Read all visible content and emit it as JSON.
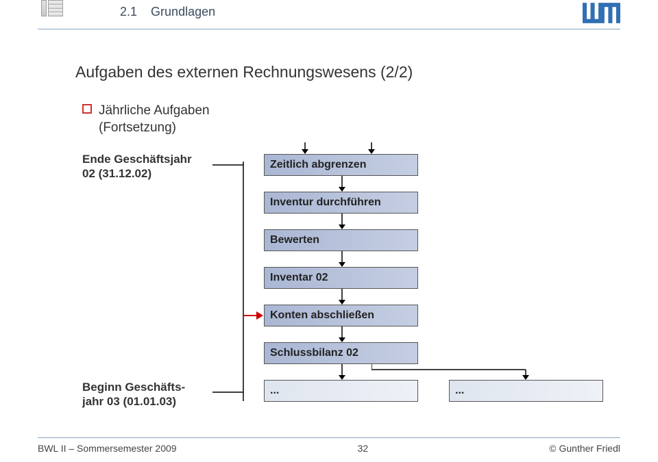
{
  "header": {
    "section_number": "2.1",
    "section_title": "Grundlagen"
  },
  "title": "Aufgaben des externen Rechnungswesens (2/2)",
  "bullet": {
    "line1": "Jährliche Aufgaben",
    "line2": "(Fortsetzung)"
  },
  "row_labels": {
    "label1_line1": "Ende Geschäftsjahr",
    "label1_line2": "02 (31.12.02)",
    "label2_line1": "Beginn Geschäfts-",
    "label2_line2": "jahr 03 (01.01.03)"
  },
  "boxes": {
    "b1": "Zeitlich abgrenzen",
    "b2": "Inventur durchführen",
    "b3": "Bewerten",
    "b4": "Inventar 02",
    "b5": "Konten abschließen",
    "b6": "Schlussbilanz 02",
    "b7": "...",
    "b8": "..."
  },
  "footer": {
    "left": "BWL II – Sommersemester 2009",
    "center": "32",
    "right": "© Gunther Friedl"
  }
}
